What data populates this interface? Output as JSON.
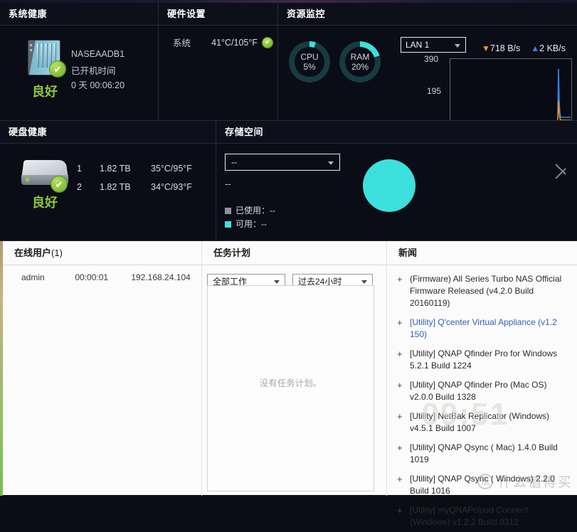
{
  "system_health": {
    "title": "系统健康",
    "status": "良好",
    "device_name": "NASEAADB1",
    "uptime_label": "已开机时间",
    "uptime_value": "0 天 00:06:20",
    "status_color": "#8cc63f"
  },
  "hardware": {
    "title": "硬件设置",
    "rows": [
      {
        "label": "系统",
        "value": "41°C/105°F",
        "status": "ok"
      }
    ]
  },
  "resource": {
    "title": "资源监控",
    "gauges": [
      {
        "name": "CPU",
        "value": "5%",
        "percent": 5
      },
      {
        "name": "RAM",
        "value": "20%",
        "percent": 20
      }
    ],
    "lan_selected": "LAN 1",
    "download_rate": "718 B/s",
    "upload_rate": "2 KB/s",
    "chart_axis_top": "390",
    "chart_axis_mid": "195",
    "accent_color": "#3ce0dc",
    "download_color": "#f0982a",
    "upload_color": "#2f86e8"
  },
  "disk_health": {
    "title": "硬盘健康",
    "status": "良好",
    "disks": [
      {
        "index": "1",
        "capacity": "1.82 TB",
        "temperature": "35°C/95°F",
        "status": "ok"
      },
      {
        "index": "2",
        "capacity": "1.82 TB",
        "temperature": "34°C/93°F",
        "status": "ok"
      }
    ]
  },
  "storage": {
    "title": "存储空间",
    "volume_selected": "--",
    "sub_value": "--",
    "legend": [
      {
        "label": "已使用：--",
        "color": "#8e939d"
      },
      {
        "label": "可用：--",
        "color": "#3ce0dc"
      }
    ]
  },
  "online_users": {
    "title": "在线用户",
    "count": "(1)",
    "rows": [
      {
        "name": "admin",
        "time": "00:00:01",
        "ip": "192.168.24.104"
      }
    ]
  },
  "task_scheduler": {
    "title": "任务计划",
    "filter_scope": "全部工作",
    "filter_range": "过去24小时",
    "empty_text": "没有任务计划。"
  },
  "news": {
    "title": "新闻",
    "plus_glyph": "+",
    "items": [
      {
        "text": "(Firmware) All Series Turbo NAS Official Firmware Released (v4.2.0 Build 20160119)",
        "link": false
      },
      {
        "text": "[Utility] Q'center Virtual Appliance (v1.2 150)",
        "link": true
      },
      {
        "text": "[Utility] QNAP Qfinder Pro for Windows 5.2.1 Build 1224",
        "link": false
      },
      {
        "text": "[Utility] QNAP Qfinder Pro (Mac OS) v2.0.0 Build 1328",
        "link": false
      },
      {
        "text": "[Utility] NetBak Replicator (Windows) v4.5.1 Build 1007",
        "link": false
      },
      {
        "text": "[Utility] QNAP Qsync ( Mac) 1.4.0 Build 1019",
        "link": false
      },
      {
        "text": "[Utility] QNAP Qsync ( Windows) 2.2.0 Build 1016",
        "link": false
      },
      {
        "text": "[Utility] myQNAPcloud Connect (Windows) v1.2.2 Build 0312",
        "link": false
      }
    ]
  },
  "watermark": {
    "badge": "值",
    "text": "什么值得买",
    "clock": "09:51"
  }
}
